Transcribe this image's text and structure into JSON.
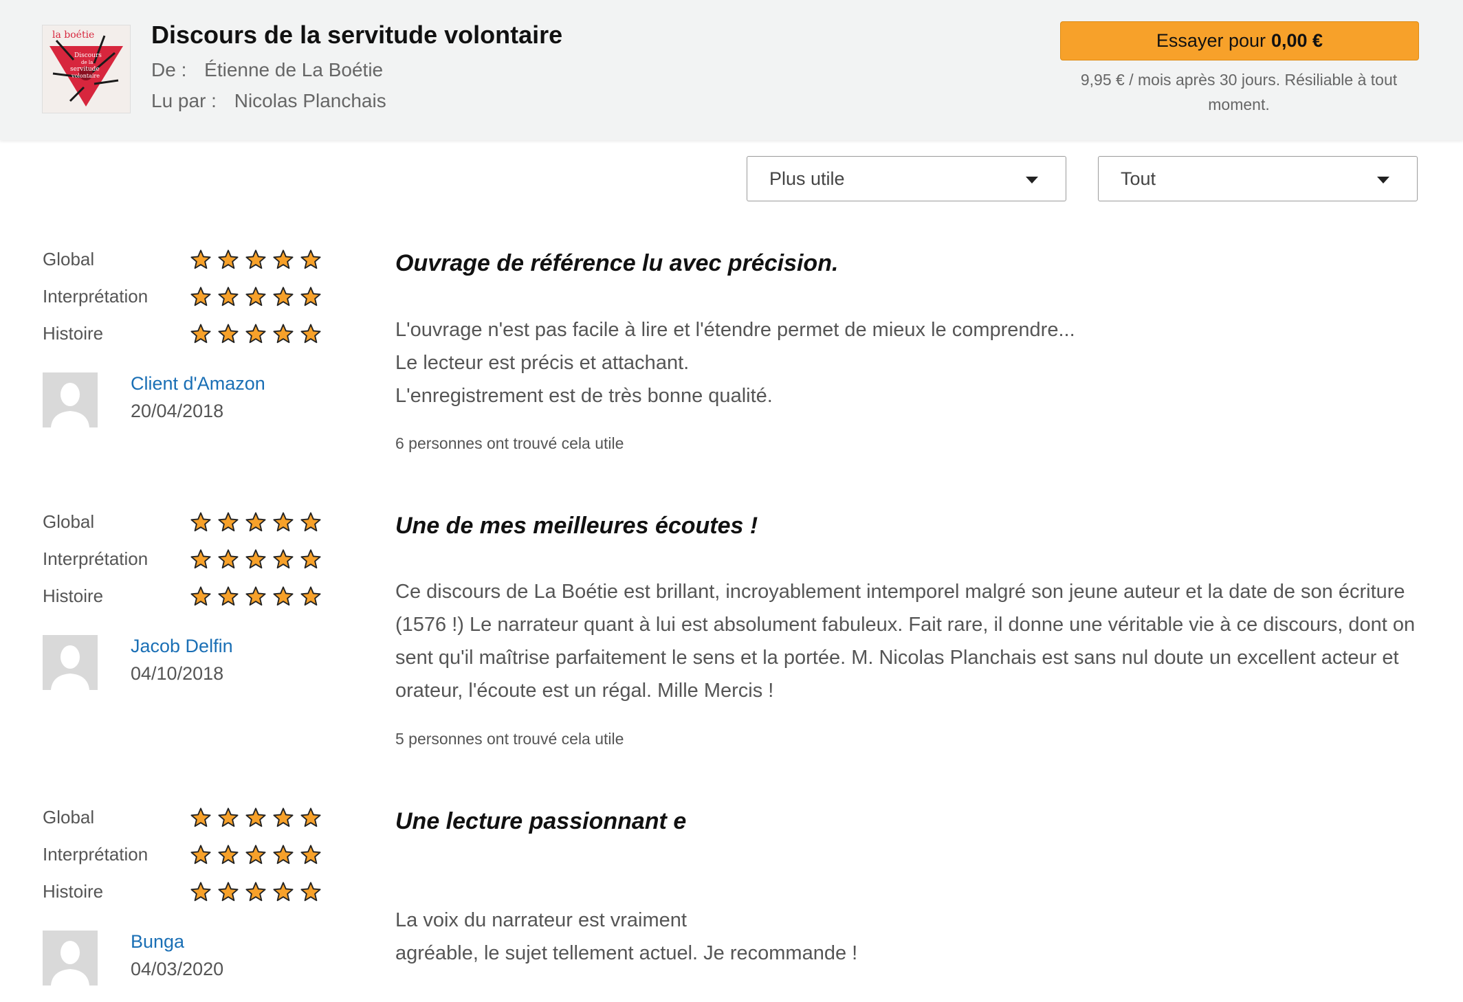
{
  "header": {
    "title": "Discours de la servitude volontaire",
    "author_label": "De :",
    "author": "Étienne de La Boétie",
    "narrator_label": "Lu par :",
    "narrator": "Nicolas Planchais",
    "cover_text": [
      "la boétie",
      "Discours",
      "de la",
      "servitude",
      "volontaire"
    ],
    "cta_prefix": "Essayer pour",
    "cta_price": "0,00 €",
    "cta_note": "9,95 € / mois après 30 jours. Résiliable à tout moment."
  },
  "filters": {
    "sort_value": "Plus utile",
    "filter_value": "Tout"
  },
  "colors": {
    "accent": "#f7a12a",
    "star_fill": "#f7a12a",
    "link": "#1a6fb5"
  },
  "reviews": [
    {
      "ratings": [
        {
          "label": "Global",
          "stars": 5
        },
        {
          "label": "Interprétation",
          "stars": 5
        },
        {
          "label": "Histoire",
          "stars": 5
        }
      ],
      "reviewer": "Client d'Amazon",
      "date": "20/04/2018",
      "title": "Ouvrage de référence lu avec précision.",
      "body": [
        "L'ouvrage n'est pas facile à lire et l'étendre permet de mieux le comprendre...",
        "Le lecteur est précis et attachant.",
        "L'enregistrement est de très bonne qualité."
      ],
      "helpful": "6 personnes ont trouvé cela utile"
    },
    {
      "ratings": [
        {
          "label": "Global",
          "stars": 5
        },
        {
          "label": "Interprétation",
          "stars": 5
        },
        {
          "label": "Histoire",
          "stars": 5
        }
      ],
      "reviewer": "Jacob Delfin",
      "date": "04/10/2018",
      "title": "Une de mes meilleures écoutes !",
      "body": [
        "Ce discours de La Boétie est brillant, incroyablement intemporel malgré son jeune auteur et la date de son écriture (1576 !) Le narrateur quant à lui est absolument fabuleux. Fait rare, il donne une véritable vie à ce discours, dont on sent qu'il maîtrise parfaitement le sens et la portée. M. Nicolas Planchais est sans nul doute un excellent acteur et orateur, l'écoute est un régal. Mille Mercis !"
      ],
      "helpful": "5 personnes ont trouvé cela utile"
    },
    {
      "ratings": [
        {
          "label": "Global",
          "stars": 5
        },
        {
          "label": "Interprétation",
          "stars": 5
        },
        {
          "label": "Histoire",
          "stars": 5
        }
      ],
      "reviewer": "Bunga",
      "date": "04/03/2020",
      "title": "Une lecture passionnant e",
      "body": [
        "La voix du narrateur est vraiment",
        "agréable, le sujet tellement actuel. Je recommande !"
      ],
      "helpful": ""
    }
  ]
}
